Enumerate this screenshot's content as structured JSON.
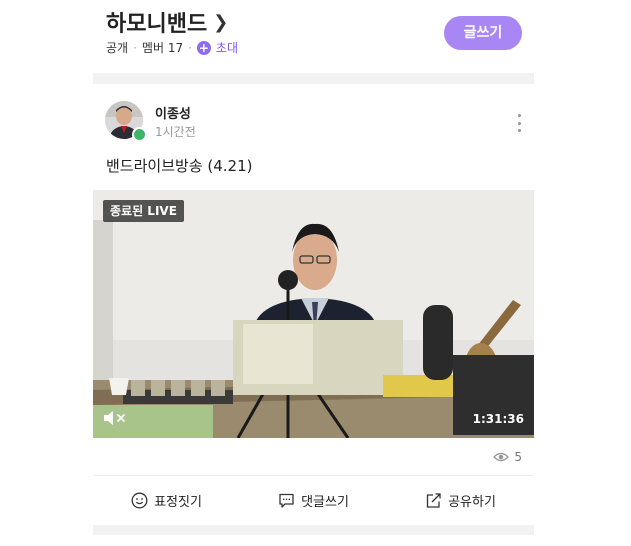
{
  "band": {
    "name": "하모니밴드",
    "visibility": "공개",
    "members_label": "멤버 17",
    "invite_label": "초대",
    "write_button": "글쓰기"
  },
  "post": {
    "author": "이종성",
    "time": "1시간전",
    "text": "밴드라이브방송 (4.21)",
    "video": {
      "status_tag": "종료된 LIVE",
      "duration": "1:31:36",
      "muted": true
    },
    "view_count": "5",
    "actions": {
      "express": "표정짓기",
      "comment": "댓글쓰기",
      "share": "공유하기"
    }
  },
  "colors": {
    "accent": "#a887f5",
    "invite": "#7a5ae6",
    "leader_badge": "#3fb56b"
  }
}
